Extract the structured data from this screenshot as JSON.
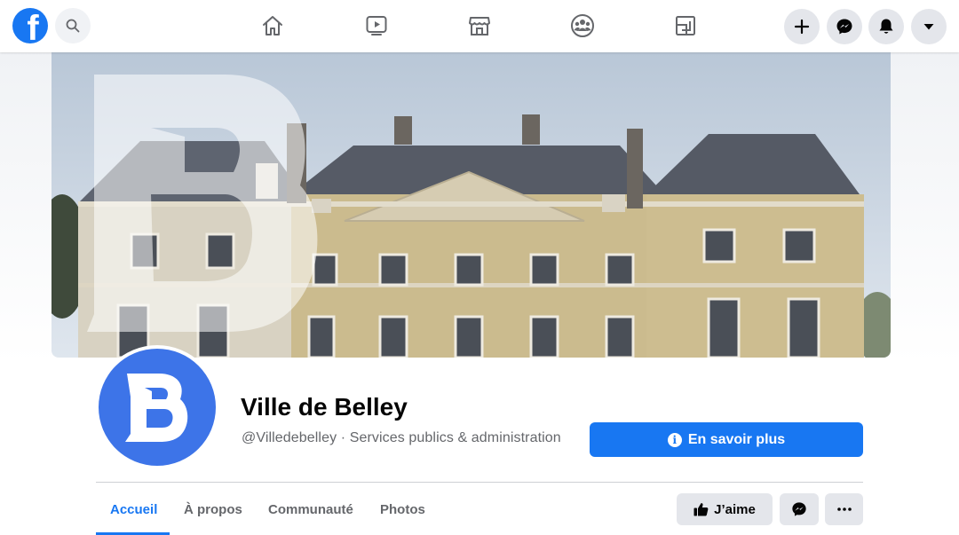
{
  "topbar": {
    "logo_letter": "f",
    "icons": [
      "facebook-logo-icon",
      "search-icon",
      "home-icon",
      "watch-icon",
      "marketplace-icon",
      "groups-icon",
      "gaming-icon",
      "create-icon",
      "messenger-icon",
      "notifications-icon",
      "account-menu-icon"
    ]
  },
  "cover": {
    "description_icons": [
      "cover-photo",
      "belley-logo-watermark"
    ]
  },
  "page": {
    "name": "Ville de Belley",
    "handle": "@Villedebelley",
    "separator": " · ",
    "category": "Services publics & administration"
  },
  "actions": {
    "learn_more_label": "En savoir plus",
    "like_label": "J’aime"
  },
  "tabs": [
    {
      "label": "Accueil",
      "active": true
    },
    {
      "label": "À propos",
      "active": false
    },
    {
      "label": "Communauté",
      "active": false
    },
    {
      "label": "Photos",
      "active": false
    }
  ],
  "colors": {
    "brand": "#1877f2",
    "logo_blue": "#3d74e8",
    "secondary_text": "#65676b",
    "button_grey": "#e4e6eb"
  }
}
